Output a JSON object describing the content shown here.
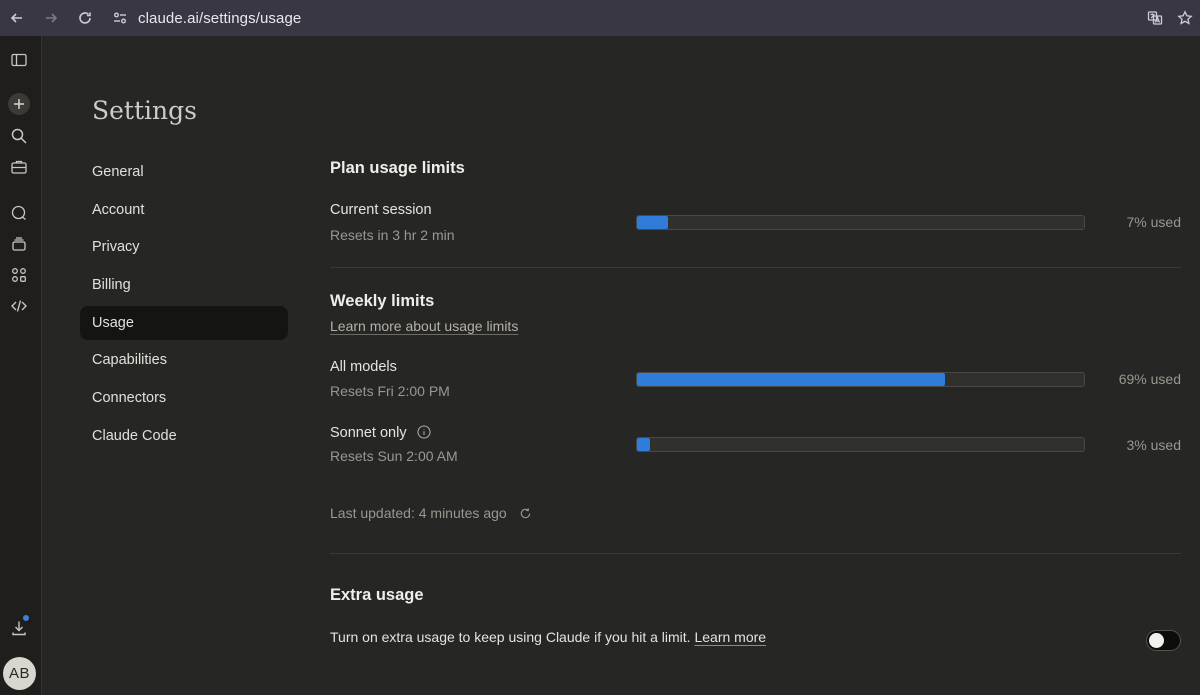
{
  "browser": {
    "url": "claude.ai/settings/usage"
  },
  "rail": {
    "avatar_initials": "AB"
  },
  "settings": {
    "title": "Settings",
    "nav": [
      {
        "label": "General"
      },
      {
        "label": "Account"
      },
      {
        "label": "Privacy"
      },
      {
        "label": "Billing"
      },
      {
        "label": "Usage",
        "active": true
      },
      {
        "label": "Capabilities"
      },
      {
        "label": "Connectors"
      },
      {
        "label": "Claude Code"
      }
    ]
  },
  "plan": {
    "heading": "Plan usage limits",
    "session": {
      "label": "Current session",
      "reset": "Resets in 3 hr 2 min",
      "percent": 7,
      "used_label": "7% used"
    }
  },
  "weekly": {
    "heading": "Weekly limits",
    "learn_link": "Learn more about usage limits",
    "all_models": {
      "label": "All models",
      "reset": "Resets Fri 2:00 PM",
      "percent": 69,
      "used_label": "69% used"
    },
    "sonnet": {
      "label": "Sonnet only",
      "reset": "Resets Sun 2:00 AM",
      "percent": 3,
      "used_label": "3% used"
    },
    "last_updated": "Last updated: 4 minutes ago"
  },
  "extra": {
    "heading": "Extra usage",
    "description": "Turn on extra usage to keep using Claude if you hit a limit.",
    "learn_more": "Learn more",
    "enabled": false
  },
  "colors": {
    "bar_fill": "#2f7dd9",
    "background": "#262624"
  }
}
